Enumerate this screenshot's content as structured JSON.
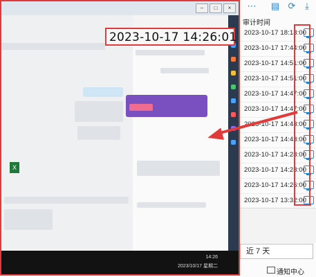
{
  "right_panel": {
    "column_header": "审计时间",
    "rows": [
      {
        "time": "2023-10-17 18:18:00"
      },
      {
        "time": "2023-10-17 17:44:00"
      },
      {
        "time": "2023-10-17 14:51:00"
      },
      {
        "time": "2023-10-17 14:51:00"
      },
      {
        "time": "2023-10-17 14:47:00"
      },
      {
        "time": "2023-10-17 14:47:00"
      },
      {
        "time": "2023-10-17 14:43:00"
      },
      {
        "time": "2023-10-17 14:43:00"
      },
      {
        "time": "2023-10-17 14:28:00"
      },
      {
        "time": "2023-10-17 14:28:00"
      },
      {
        "time": "2023-10-17 14:26:00"
      },
      {
        "time": "2023-10-17 13:32:00"
      }
    ],
    "top_icons": [
      "more-icon",
      "book-icon",
      "refresh-icon",
      "download-icon"
    ],
    "row_icon": "monitor-icon",
    "range_select": "近 7 天",
    "notification": "通知中心"
  },
  "screenshot_window": {
    "timestamp": "2023-10-17 14:26:01",
    "taskbar_time": "14:26",
    "taskbar_date": "2023/10/17 星期二",
    "excel_icon_letter": "X"
  },
  "colors": {
    "highlight_red": "#e23a3a",
    "accent_blue": "#1e86d8"
  }
}
